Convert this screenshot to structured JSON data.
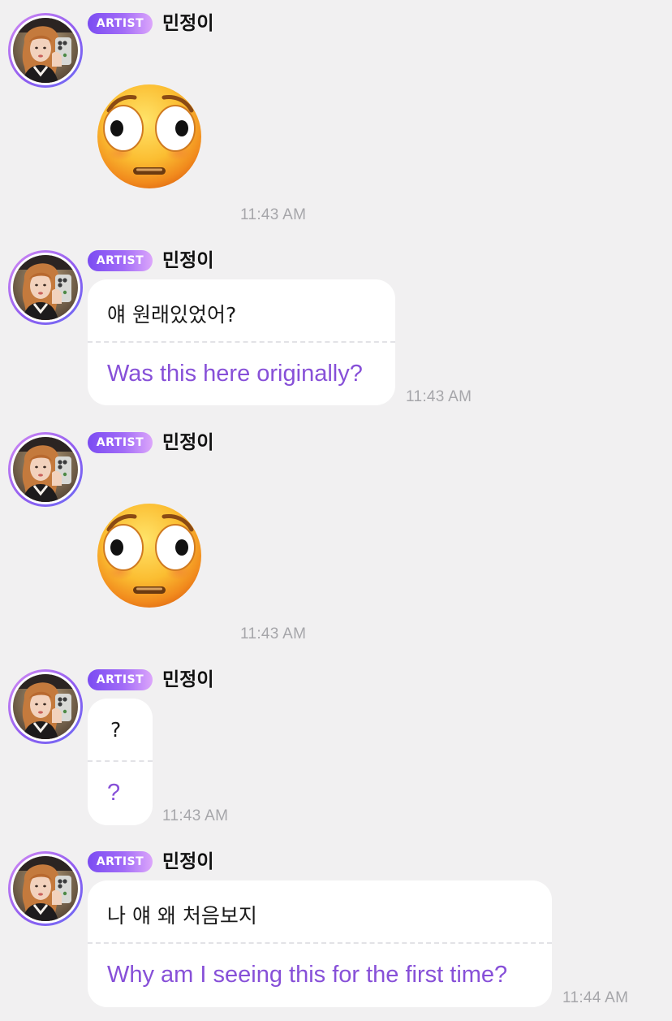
{
  "colors": {
    "background": "#f1f0f1",
    "bubble": "#ffffff",
    "translation_text": "#8750d8",
    "timestamp_text": "#a6a6aa",
    "badge_gradient_start": "#7b4cf2",
    "badge_gradient_end": "#dca6fb"
  },
  "messages": [
    {
      "type": "emoji",
      "badge": "ARTIST",
      "sender": "민정이",
      "emoji": "flushed-face-emoji",
      "time": "11:43 AM"
    },
    {
      "type": "text",
      "badge": "ARTIST",
      "sender": "민정이",
      "original": "얘 원래있었어?",
      "translation": "Was this here originally?",
      "time": "11:43 AM"
    },
    {
      "type": "emoji",
      "badge": "ARTIST",
      "sender": "민정이",
      "emoji": "flushed-face-emoji",
      "time": "11:43 AM"
    },
    {
      "type": "text",
      "badge": "ARTIST",
      "sender": "민정이",
      "original": "?",
      "translation": "?",
      "time": "11:43 AM"
    },
    {
      "type": "text",
      "badge": "ARTIST",
      "sender": "민정이",
      "original": "나 얘 왜 처음보지",
      "translation": "Why am I seeing this for the first time?",
      "time": "11:44 AM"
    }
  ]
}
